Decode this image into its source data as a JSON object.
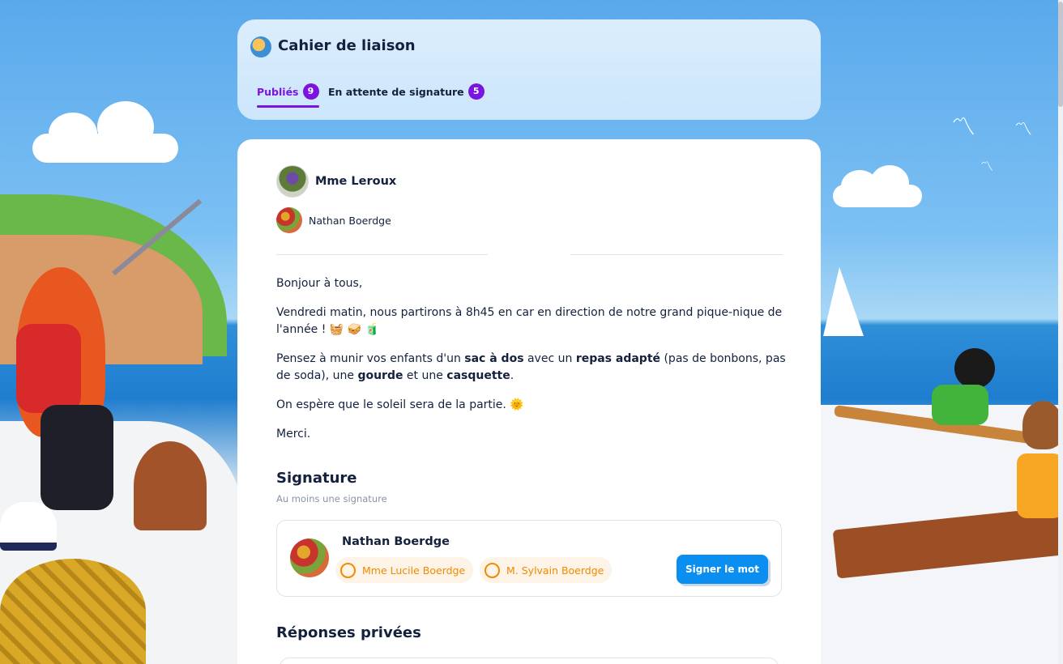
{
  "header": {
    "title": "Cahier de liaison",
    "tabs": [
      {
        "label": "Publiés",
        "count": "9",
        "active": true
      },
      {
        "label": "En attente de signature",
        "count": "5",
        "active": false
      }
    ]
  },
  "post": {
    "author": "Mme Leroux",
    "recipient": "Nathan Boerdge",
    "message": {
      "greeting": "Bonjour à tous,",
      "p1": "Vendredi matin, nous partirons à 8h45 en car en direction de notre grand pique-nique de l'année ! 🧺 🥪 🧃",
      "p2_parts": {
        "a": "Pensez à munir vos enfants d'un ",
        "b": "sac à dos",
        "c": " avec un ",
        "d": "repas adapté",
        "e": " (pas de bonbons, pas de soda), une ",
        "f": "gourde",
        "g": " et une ",
        "h": "casquette",
        "i": "."
      },
      "p3": "On espère que le soleil sera de la partie. 🌞",
      "closing": "Merci."
    }
  },
  "signature": {
    "title": "Signature",
    "subtitle": "Au moins une signature",
    "child_name": "Nathan Boerdge",
    "parents": [
      "Mme Lucile Boerdge",
      "M. Sylvain Boerdge"
    ],
    "button_label": "Signer le mot"
  },
  "replies": {
    "title": "Réponses privées"
  },
  "colors": {
    "accent": "#7a14e0",
    "primary_button": "#0a8ff0",
    "parent_chip": "#f08a00"
  }
}
